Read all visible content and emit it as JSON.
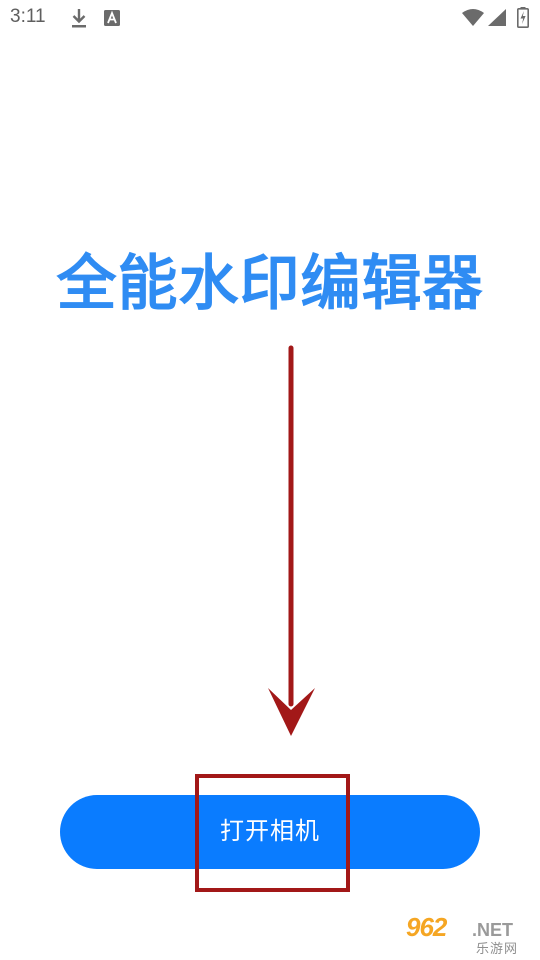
{
  "status_bar": {
    "time": "3:11",
    "icons": [
      "download-icon",
      "accessibility-a-icon",
      "wifi-icon",
      "cell-signal-icon",
      "battery-charging-icon"
    ]
  },
  "title": "全能水印编辑器",
  "camera_button": {
    "label": "打开相机"
  },
  "colors": {
    "title": "#2f8cf3",
    "button": "#0a7cff",
    "annotation": "#a21818"
  },
  "watermark": {
    "brand": "962",
    "domain": ".NET",
    "subtitle": "乐游网"
  }
}
